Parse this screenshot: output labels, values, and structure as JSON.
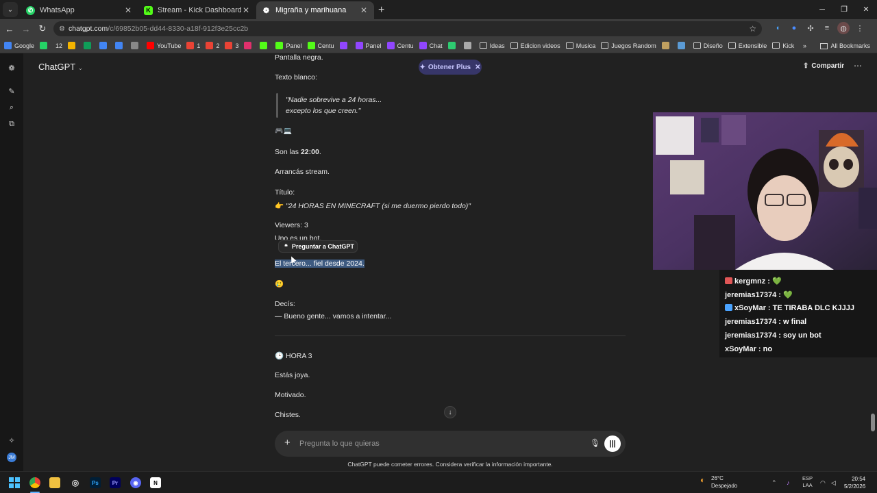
{
  "browser": {
    "tabs": [
      {
        "title": "WhatsApp",
        "icon": "whatsapp-icon",
        "color": "#25d366"
      },
      {
        "title": "Stream - Kick Dashboard",
        "icon": "kick-icon",
        "color": "#53fc18"
      },
      {
        "title": "Migraña y marihuana",
        "icon": "chatgpt-icon",
        "color": "#ffffff",
        "active": true
      }
    ],
    "url_host": "chatgpt.com",
    "url_path": "/c/69852b05-dd44-8330-a18f-912f3e25cc2b",
    "bookmarks": [
      {
        "label": "Google",
        "icon": "google-icon",
        "color": "#4285f4"
      },
      {
        "label": "",
        "icon": "whatsapp-icon",
        "color": "#25d366"
      },
      {
        "label": "12",
        "icon": "",
        "color": ""
      },
      {
        "label": "",
        "icon": "drive-icon",
        "color": "#f4b400"
      },
      {
        "label": "",
        "icon": "sheets-icon",
        "color": "#0f9d58"
      },
      {
        "label": "",
        "icon": "docs-icon",
        "color": "#4285f4"
      },
      {
        "label": "",
        "icon": "calendar-icon",
        "color": "#4285f4"
      },
      {
        "label": "",
        "icon": "chatgpt-icon",
        "color": "#888888"
      },
      {
        "label": "YouTube",
        "icon": "youtube-icon",
        "color": "#ff0000"
      },
      {
        "label": "1",
        "icon": "gmail-icon",
        "color": "#ea4335"
      },
      {
        "label": "2",
        "icon": "gmail-icon",
        "color": "#ea4335"
      },
      {
        "label": "3",
        "icon": "gmail-icon",
        "color": "#ea4335"
      },
      {
        "label": "",
        "icon": "instagram-icon",
        "color": "#e1306c"
      },
      {
        "label": "",
        "icon": "kick-icon",
        "color": "#53fc18"
      },
      {
        "label": "Panel",
        "icon": "kick-icon",
        "color": "#53fc18"
      },
      {
        "label": "Centu",
        "icon": "kick-icon",
        "color": "#53fc18"
      },
      {
        "label": "",
        "icon": "twitch-icon",
        "color": "#9146ff"
      },
      {
        "label": "Panel",
        "icon": "twitch-icon",
        "color": "#9146ff"
      },
      {
        "label": "Centu",
        "icon": "twitch-icon",
        "color": "#9146ff"
      },
      {
        "label": "Chat",
        "icon": "twitch-icon",
        "color": "#9146ff"
      },
      {
        "label": "",
        "icon": "app-icon",
        "color": "#2ecc71"
      },
      {
        "label": "",
        "icon": "settings-icon",
        "color": "#aaaaaa"
      },
      {
        "label": "Ideas",
        "icon": "folder-icon",
        "color": ""
      },
      {
        "label": "Edicion videos",
        "icon": "folder-icon",
        "color": ""
      },
      {
        "label": "Musica",
        "icon": "folder-icon",
        "color": ""
      },
      {
        "label": "Juegos Random",
        "icon": "folder-icon",
        "color": ""
      },
      {
        "label": "",
        "icon": "game-icon",
        "color": "#c0a060"
      },
      {
        "label": "",
        "icon": "globe-icon",
        "color": "#5b9bd5"
      },
      {
        "label": "Diseño",
        "icon": "folder-icon",
        "color": ""
      },
      {
        "label": "Extensible",
        "icon": "folder-icon",
        "color": ""
      },
      {
        "label": "Kick",
        "icon": "folder-icon",
        "color": ""
      }
    ],
    "all_bookmarks": "All Bookmarks"
  },
  "app": {
    "name": "ChatGPT",
    "plus_button": "Obtener Plus",
    "share_button": "Compartir",
    "ask_tooltip": "Preguntar a ChatGPT",
    "composer_placeholder": "Pregunta lo que quieras",
    "disclaimer": "ChatGPT puede cometer errores. Considera verificar la información importante."
  },
  "conversation": {
    "l1": "Pantalla negra.",
    "l2": "Texto blanco:",
    "q1": "\"Nadie sobrevive a 24 horas...",
    "q2": "excepto los que creen.\"",
    "emoji1": "🎮💻",
    "l3a": "Son las ",
    "l3b": "22:00",
    "l3c": ".",
    "l4": "Arrancás stream.",
    "l5": "Título:",
    "l6a": "👉 ",
    "l6b": "\"24 HORAS EN MINECRAFT (si me duermo pierdo todo)\"",
    "l7": "Viewers: 3",
    "l8": "Uno es un bot.",
    "l9": "El tercero... fiel desde 2024.",
    "emoji2": "🥲",
    "l10": "Decís:",
    "l11": "— Bueno gente... vamos a intentar...",
    "h3": "🕒 HORA 3",
    "l12": "Estás joya.",
    "l13": "Motivado.",
    "l14": "Chistes."
  },
  "stream_chat": [
    {
      "user": "kergmnz",
      "text": "💚",
      "badge": "#e05656"
    },
    {
      "user": "jeremias17374",
      "text": "💚",
      "badge": ""
    },
    {
      "user": "xSoyMar",
      "text": "TE TIRABA DLC KJJJJ",
      "badge": "#4aa3ff"
    },
    {
      "user": "jeremias17374",
      "text": "w final",
      "badge": ""
    },
    {
      "user": "jeremias17374",
      "text": "soy un bot",
      "badge": ""
    },
    {
      "user": "xSoyMar",
      "text": "no",
      "badge": ""
    }
  ],
  "taskbar": {
    "temp": "26°C",
    "weather": "Despejado",
    "weather_badge": "6",
    "lang1": "ESP",
    "lang2": "LAA",
    "time": "20:54",
    "date": "5/2/2026"
  }
}
